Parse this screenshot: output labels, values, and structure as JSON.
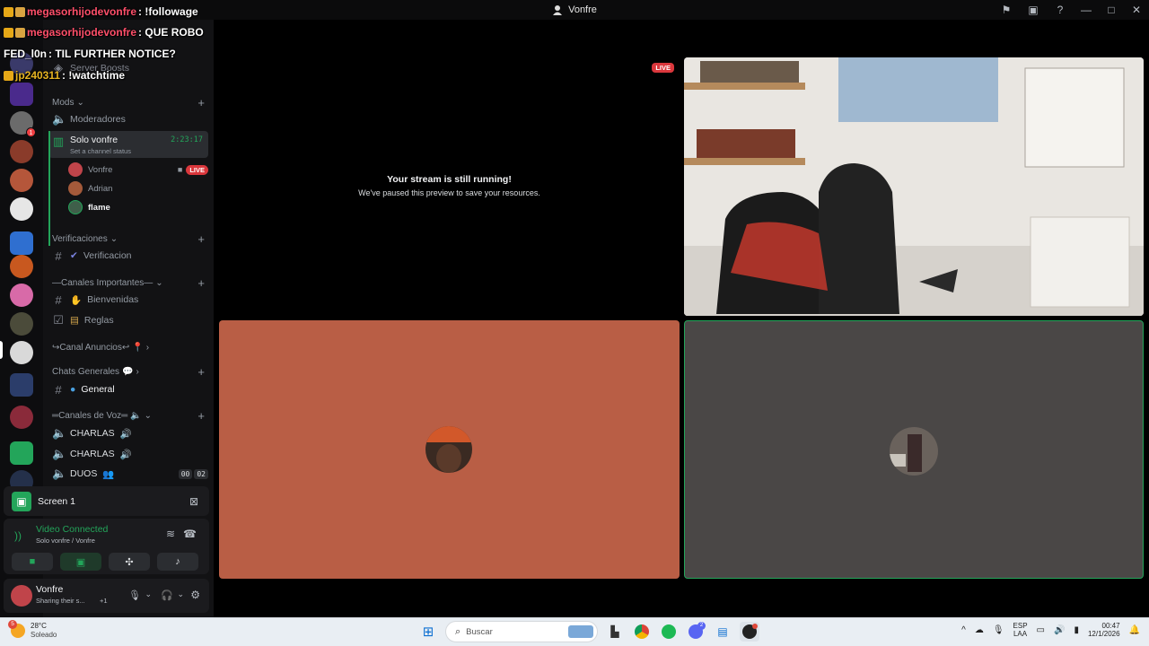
{
  "window": {
    "title": "Vonfre"
  },
  "chat_overlay": [
    {
      "user": "megasorhijodevonfre",
      "msg": ": !followage",
      "color": "#ff4f6a"
    },
    {
      "user": "megasorhijodevonfre",
      "msg": ": QUE ROBO",
      "color": "#ff4f6a"
    },
    {
      "user": "FED_l0n",
      "msg": ": TIL FURTHER NOTICE?",
      "color": "#ffffff"
    },
    {
      "user": "jp240311",
      "msg": ": !watchtime",
      "color": "#e6b422"
    }
  ],
  "sidebar": {
    "server_boosts": "Server Boosts",
    "cat_mods": "Mods",
    "moderadores": "Moderadores",
    "solo_vonfre": "Solo vonfre",
    "solo_timer": "2:23:17",
    "channel_status": "Set a channel status",
    "vc_users": [
      {
        "name": "Vonfre",
        "live": "LIVE"
      },
      {
        "name": "Adrian"
      },
      {
        "name": "flame"
      }
    ],
    "cat_verificaciones": "Verificaciones",
    "verificacion": "Verificacion",
    "cat_importantes": "—Canales Importantes—",
    "bienvenidas": "Bienvenidas",
    "reglas": "Reglas",
    "cat_anuncios": "↪Canal Anuncios↩",
    "cat_generales": "Chats Generales",
    "general": "General",
    "cat_voz": "═Canales de Voz═",
    "charlas1": "CHARLAS",
    "charlas2": "CHARLAS",
    "duos": "DUOS",
    "duos_count_a": "00",
    "duos_count_b": "02"
  },
  "screen_panel": {
    "label": "Screen 1"
  },
  "voice_panel": {
    "status": "Video Connected",
    "sub": "Solo vonfre / Vonfre"
  },
  "user_panel": {
    "name": "Vonfre",
    "status": "Sharing their s...",
    "extra": "+1"
  },
  "stage": {
    "live": "LIVE",
    "paused_title": "Your stream is still running!",
    "paused_sub": "We've paused this preview to save your resources."
  },
  "taskbar": {
    "temp": "28°C",
    "weather": "Soleado",
    "weather_badge": "5",
    "search": "Buscar",
    "discord_badge": "2",
    "lang1": "ESP",
    "lang2": "LAA",
    "time": "00:47",
    "date": "12/1/2026"
  },
  "colors": {
    "accent": "#23a55a",
    "live": "#da373c",
    "tile_orange": "#b95e45",
    "tile_gray": "#4a4746"
  }
}
